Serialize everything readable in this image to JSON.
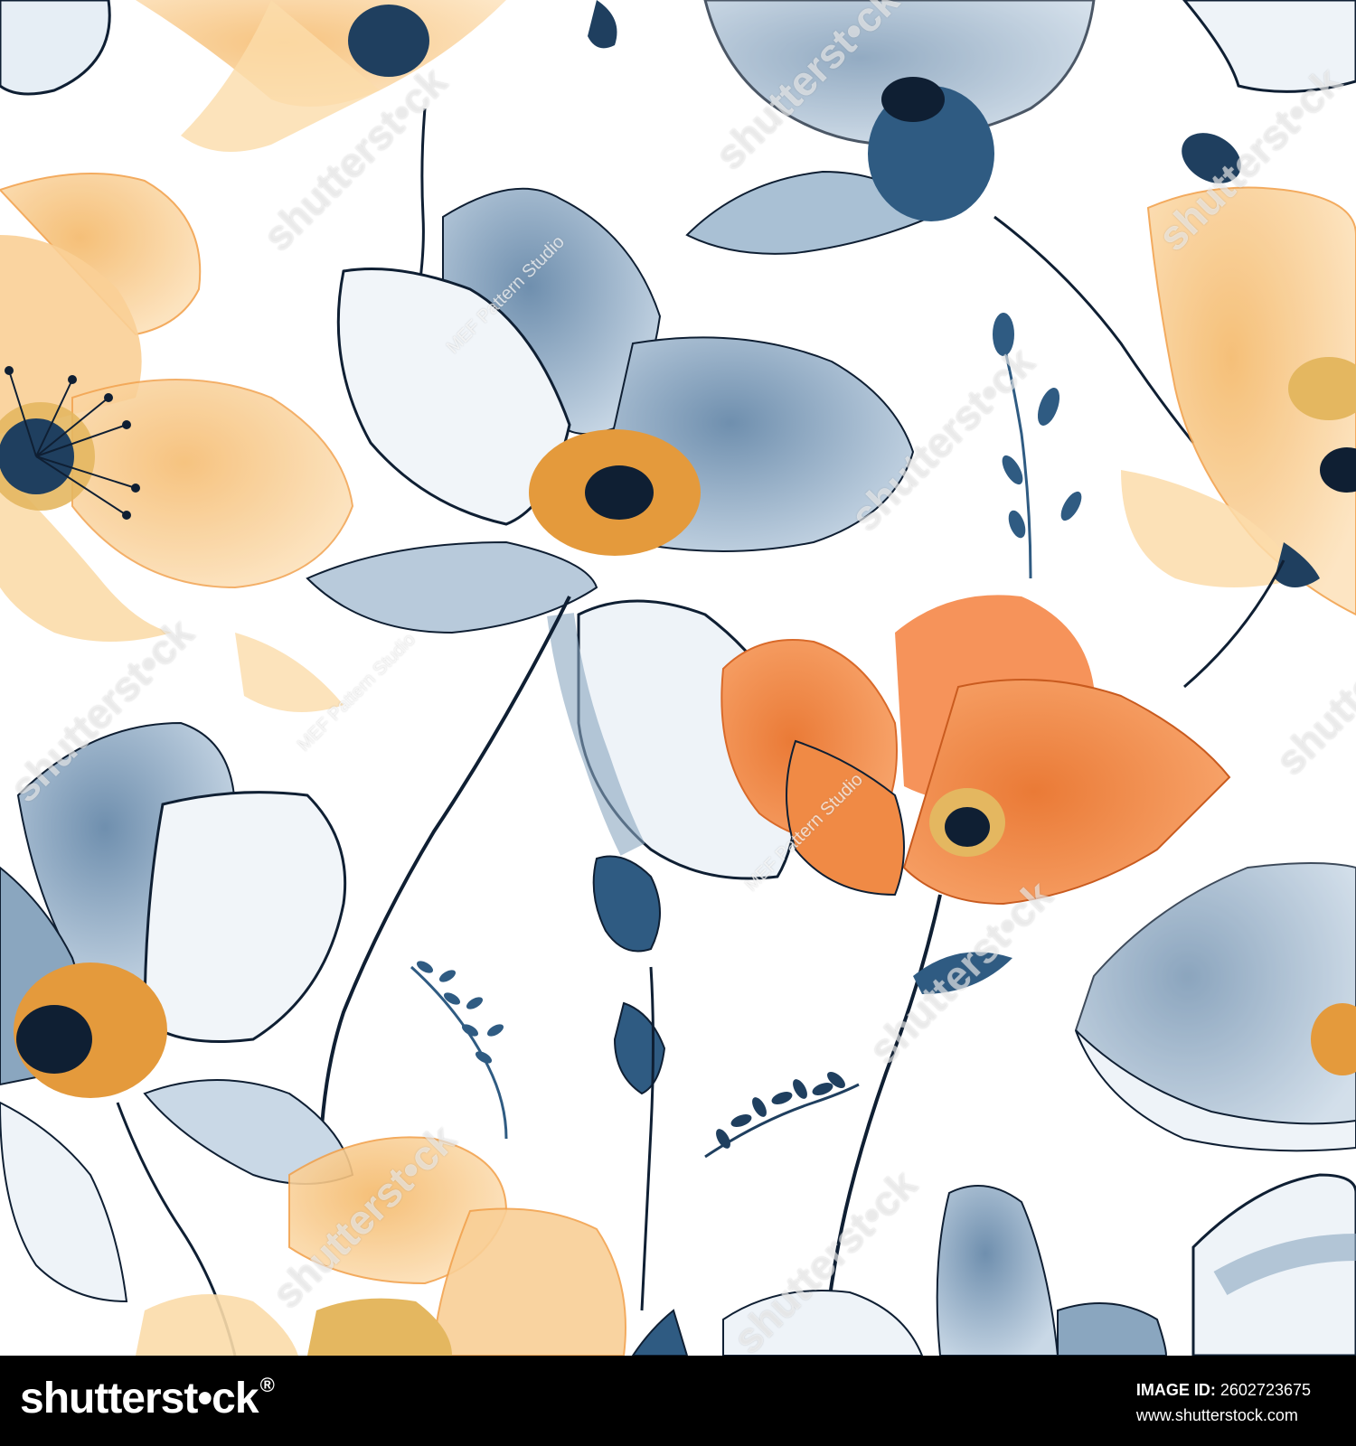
{
  "image": {
    "subject": "seamless floral pattern",
    "palette": {
      "background": "#ffffff",
      "blue_petal": "#8aa6bf",
      "pale_blue": "#dde7ef",
      "navy": "#1f3f5f",
      "outline": "#0f1f33",
      "peach": "#f7c98a",
      "light_peach": "#fbdcaa",
      "orange": "#f08a45",
      "stamen": "#e49a3c"
    }
  },
  "watermarks": {
    "site": "shutterst•ck",
    "studio": "MEF Pattern Studio"
  },
  "footer": {
    "brand": "shutterst•ck",
    "brand_mark": "®",
    "image_id_label": "IMAGE ID:",
    "image_id": "2602723675",
    "site_url": "www.shutterstock.com"
  }
}
